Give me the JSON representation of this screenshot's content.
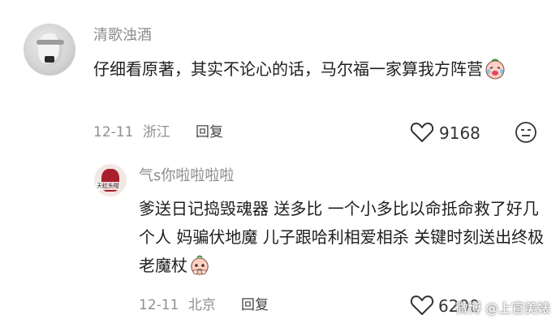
{
  "comments": [
    {
      "username": "清歌浊酒",
      "text": "仔细看原著，其实不论心的话，马尔福一家算我方阵营",
      "emoji": "crying-laugh-emoji",
      "date": "12-11",
      "location": "浙江",
      "reply_label": "回复",
      "likes": "9168",
      "dislike_icon": "dislike-face-icon"
    },
    {
      "username": "气s你啦啦啦啦",
      "avatar_text": "天红头啦",
      "text": "爹送日记捣毁魂器 送多比 一个小多比以命抵命救了好几个人 妈骗伏地魔 儿子跟哈利相爱相杀 关键时刻送出终极老魔杖",
      "emoji": "pleading-peach-emoji",
      "date": "12-11",
      "location": "北京",
      "reply_label": "回复",
      "likes": "6200"
    }
  ],
  "watermark": "微博 @上官美婊",
  "colors": {
    "meta": "#8f8f8f",
    "text": "#1e1e1e",
    "name": "#8b8b8b"
  }
}
